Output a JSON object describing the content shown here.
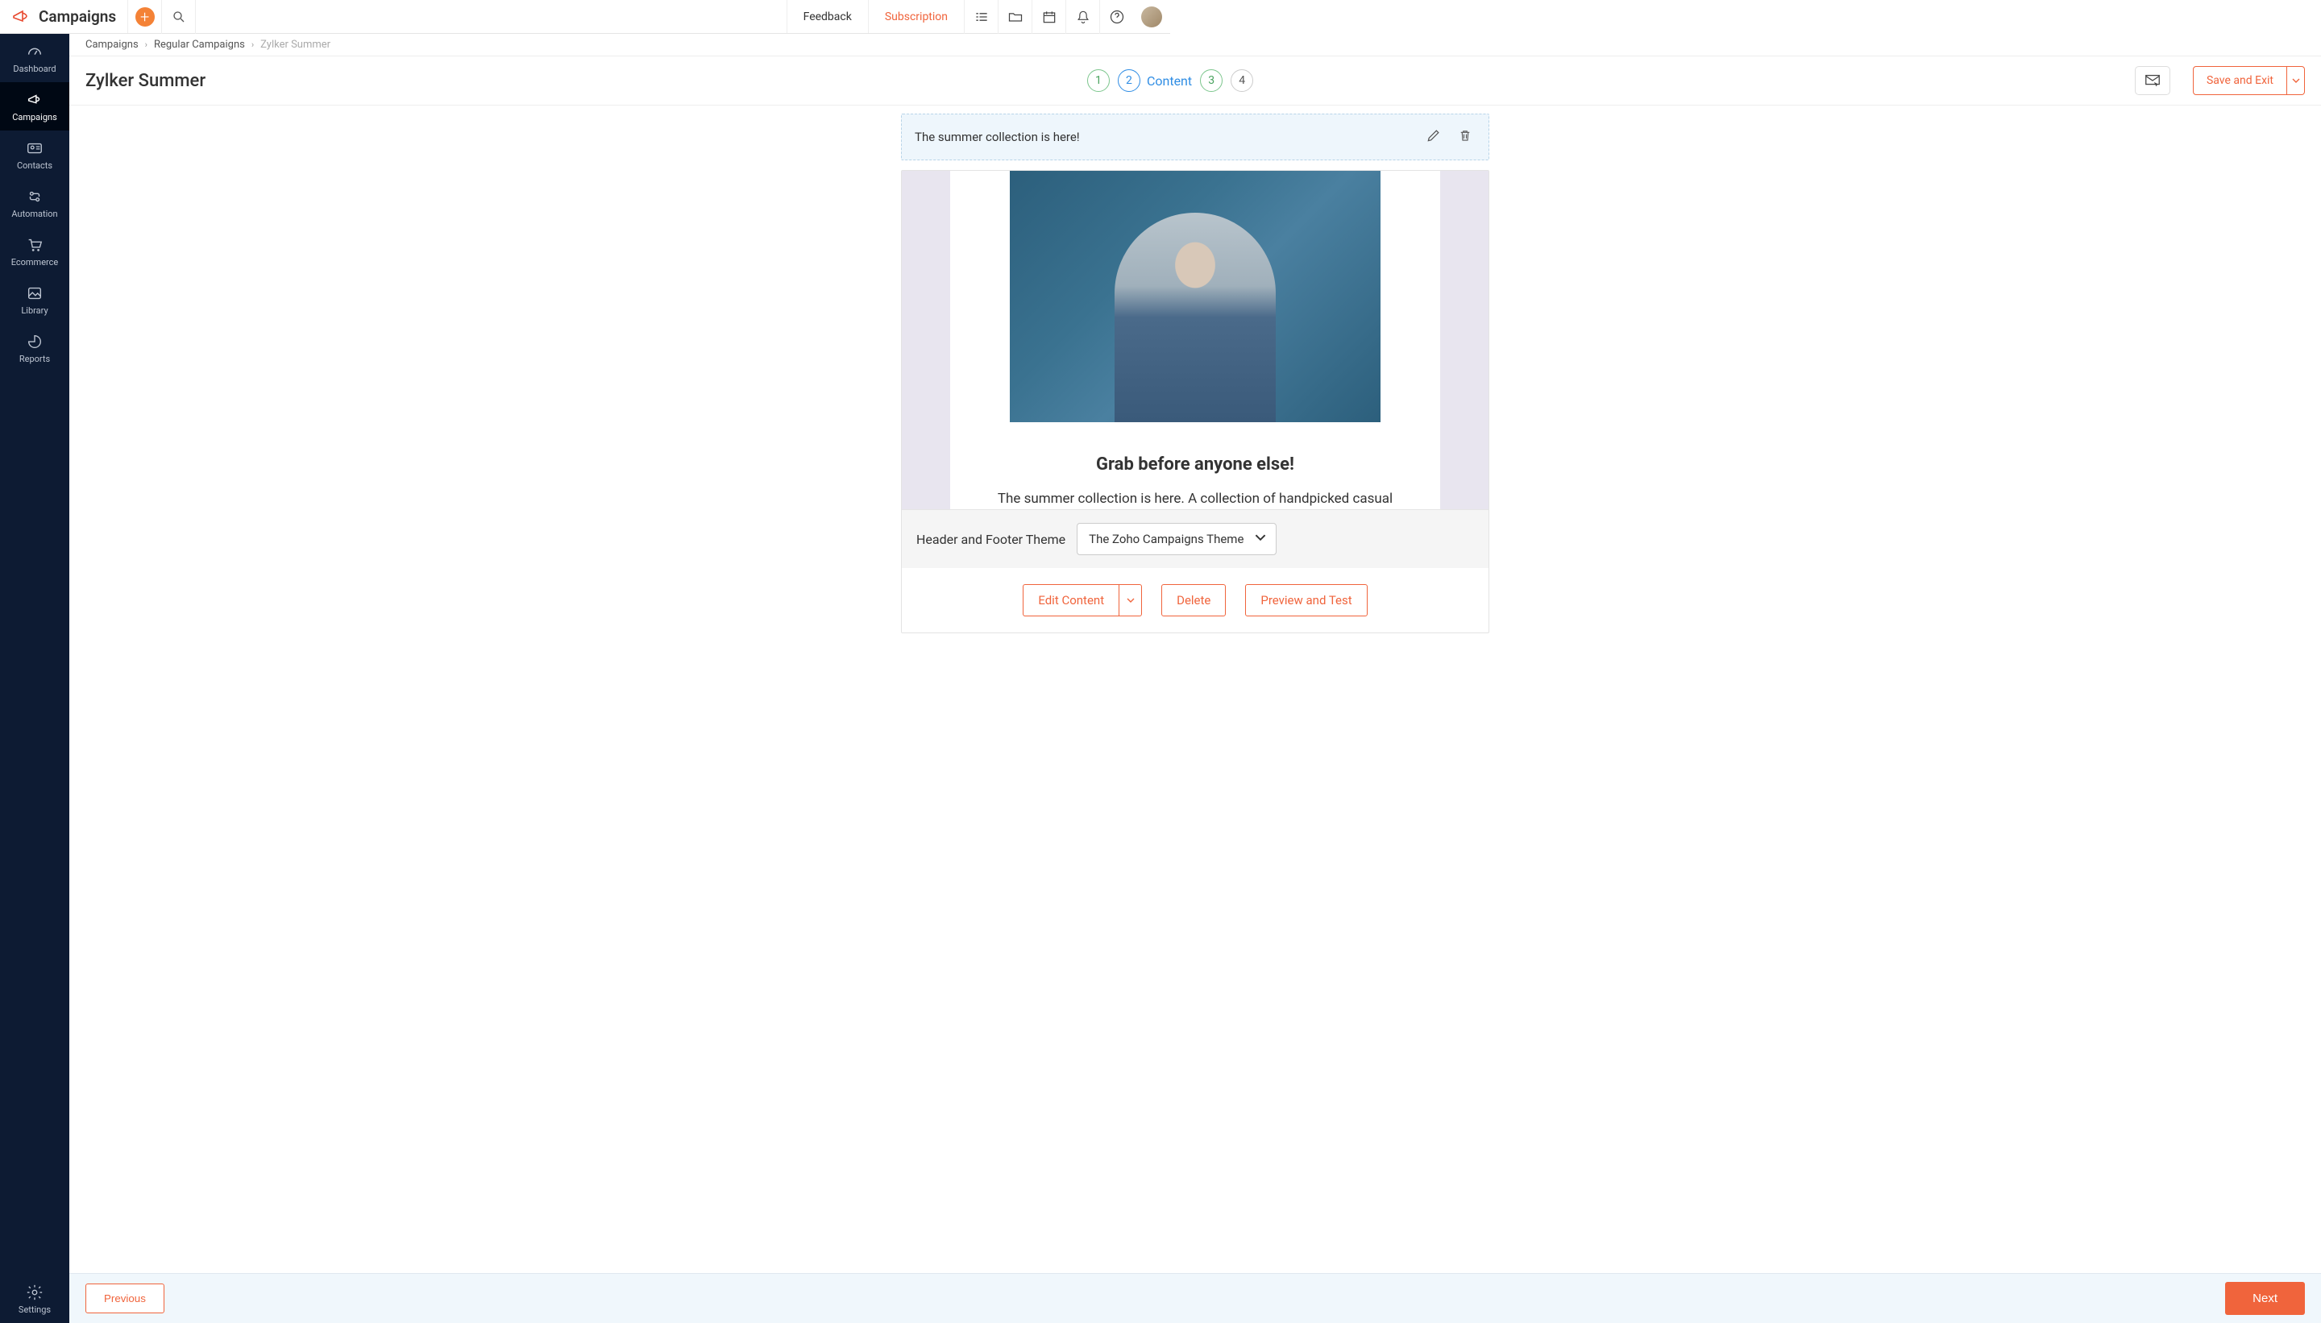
{
  "header": {
    "app_name": "Campaigns",
    "feedback": "Feedback",
    "subscription": "Subscription"
  },
  "sidebar": {
    "items": [
      {
        "id": "dashboard",
        "label": "Dashboard"
      },
      {
        "id": "campaigns",
        "label": "Campaigns"
      },
      {
        "id": "contacts",
        "label": "Contacts"
      },
      {
        "id": "automation",
        "label": "Automation"
      },
      {
        "id": "ecommerce",
        "label": "Ecommerce"
      },
      {
        "id": "library",
        "label": "Library"
      },
      {
        "id": "reports",
        "label": "Reports"
      }
    ],
    "settings": "Settings",
    "active": "campaigns"
  },
  "breadcrumbs": {
    "root": "Campaigns",
    "mid": "Regular Campaigns",
    "current": "Zylker Summer"
  },
  "page": {
    "title": "Zylker Summer",
    "save_label": "Save and Exit"
  },
  "steps": {
    "s1": "1",
    "s2": "2",
    "s2_label": "Content",
    "s3": "3",
    "s4": "4",
    "active": 2
  },
  "subject": {
    "text": "The summer collection is here!"
  },
  "email": {
    "headline": "Grab before anyone else!",
    "subtext": "The summer collection is here. A collection of handpicked casual"
  },
  "theme": {
    "label": "Header and Footer Theme",
    "selected": "The Zoho Campaigns Theme"
  },
  "actions": {
    "edit": "Edit Content",
    "delete": "Delete",
    "preview": "Preview and Test"
  },
  "footer": {
    "previous": "Previous",
    "next": "Next"
  }
}
